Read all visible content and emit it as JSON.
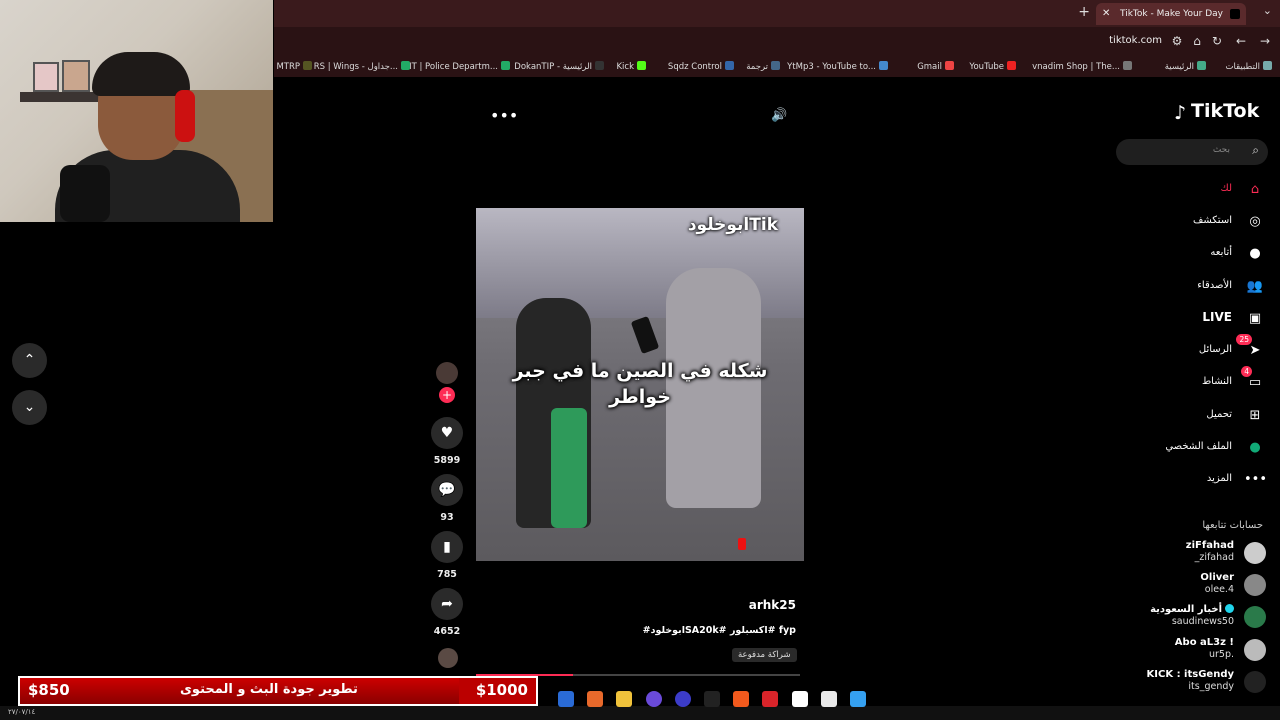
{
  "browser": {
    "tab_title": "TikTok - Make Your Day",
    "tab_close": "✕",
    "new_tab": "+",
    "tab_menu": "⌄",
    "url": "tiktok.com",
    "bookmarks": [
      "التطبيقات",
      "الرئيسية",
      "vnadim Shop | The...",
      "YouTube",
      "Gmail",
      "YtMp3 - YouTube to...",
      "ترجمة",
      "Sqdz Control",
      "Kick",
      "DokanTIP - الرئيسية",
      "MT | Police Departm...",
      "RS | Wings - جداول...",
      "MTRP"
    ]
  },
  "side_nav": {
    "up": "⌃",
    "down": "⌄"
  },
  "video": {
    "watermark": "ابوخلودTik",
    "caption_line1": "شكله في الصين ما في جبر",
    "caption_line2": "خواطر",
    "progress": 0.3,
    "more": "•••",
    "volume": "🔊"
  },
  "actions": {
    "likes": "5899",
    "comments": "93",
    "saves": "785",
    "shares": "4652"
  },
  "post": {
    "author": "arhk25",
    "tags": "#ابوخلودSA20k# اكسبلور# fyp",
    "paid": "شراكة مدفوعة"
  },
  "sidebar": {
    "logo": "TikTok",
    "search_placeholder": "بحث",
    "items": [
      {
        "label": "لك",
        "icon": "home-icon",
        "glyph": "⌂"
      },
      {
        "label": "استكشف",
        "icon": "compass-icon",
        "glyph": "◎"
      },
      {
        "label": "أتابعه",
        "icon": "avatar-icon",
        "glyph": "●"
      },
      {
        "label": "الأصدقاء",
        "icon": "friends-icon",
        "glyph": "👥"
      },
      {
        "label": "LIVE",
        "icon": "live-icon",
        "glyph": "▣"
      },
      {
        "label": "الرسائل",
        "icon": "messages-icon",
        "glyph": "➤",
        "badge": "25"
      },
      {
        "label": "النشاط",
        "icon": "activity-icon",
        "glyph": "▭",
        "badge": "4"
      },
      {
        "label": "تحميل",
        "icon": "upload-icon",
        "glyph": "⊞"
      },
      {
        "label": "الملف الشخصي",
        "icon": "profile-icon",
        "glyph": "●"
      },
      {
        "label": "المزيد",
        "icon": "more-icon",
        "glyph": "•••"
      }
    ],
    "following_header": "حسابات تتابعها",
    "accounts": [
      {
        "name": "ziFfahad",
        "handle": "_zifahad"
      },
      {
        "name": "Oliver",
        "handle": "olee.4"
      },
      {
        "name": "أخبار السعودية",
        "handle": "saudinews50",
        "verified": true
      },
      {
        "name": "Abo aL3z !",
        "handle": "ur5p."
      },
      {
        "name": "KICK : itsGendy",
        "handle": "its_gendy"
      }
    ]
  },
  "donation": {
    "current": "$850",
    "title": "تطوير جودة البث و المحتوى",
    "goal": "$1000",
    "fraction": 0.85
  },
  "colors": {
    "accent": "#fe2c55",
    "donation_red": "#b00000",
    "browser_tab": "#3a1a1c"
  },
  "taskbar": {
    "date": "٢٧/٠٧/١٤"
  }
}
